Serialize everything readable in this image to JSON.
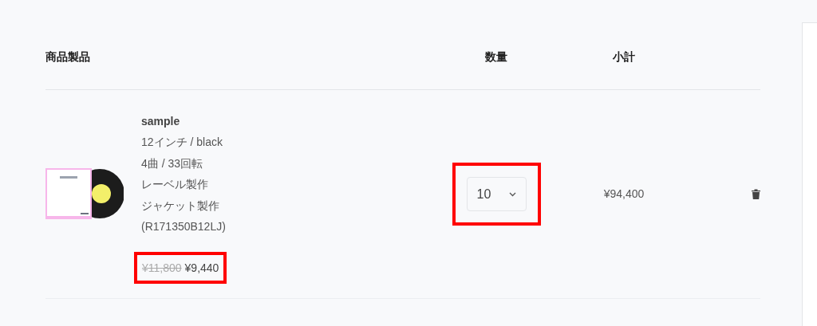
{
  "table": {
    "columns": [
      "商品製品",
      "数量",
      "小計"
    ],
    "rows": [
      {
        "name": "sample",
        "details": [
          "12インチ / black",
          "4曲 / 33回転",
          "レーベル製作",
          "ジャケット製作",
          "(R171350B12LJ)"
        ],
        "old_price": "¥11,800",
        "price": "¥9,440",
        "price_highlighted": true,
        "quantity": "10",
        "quantity_highlighted": true,
        "subtotal": "¥94,400"
      }
    ]
  }
}
